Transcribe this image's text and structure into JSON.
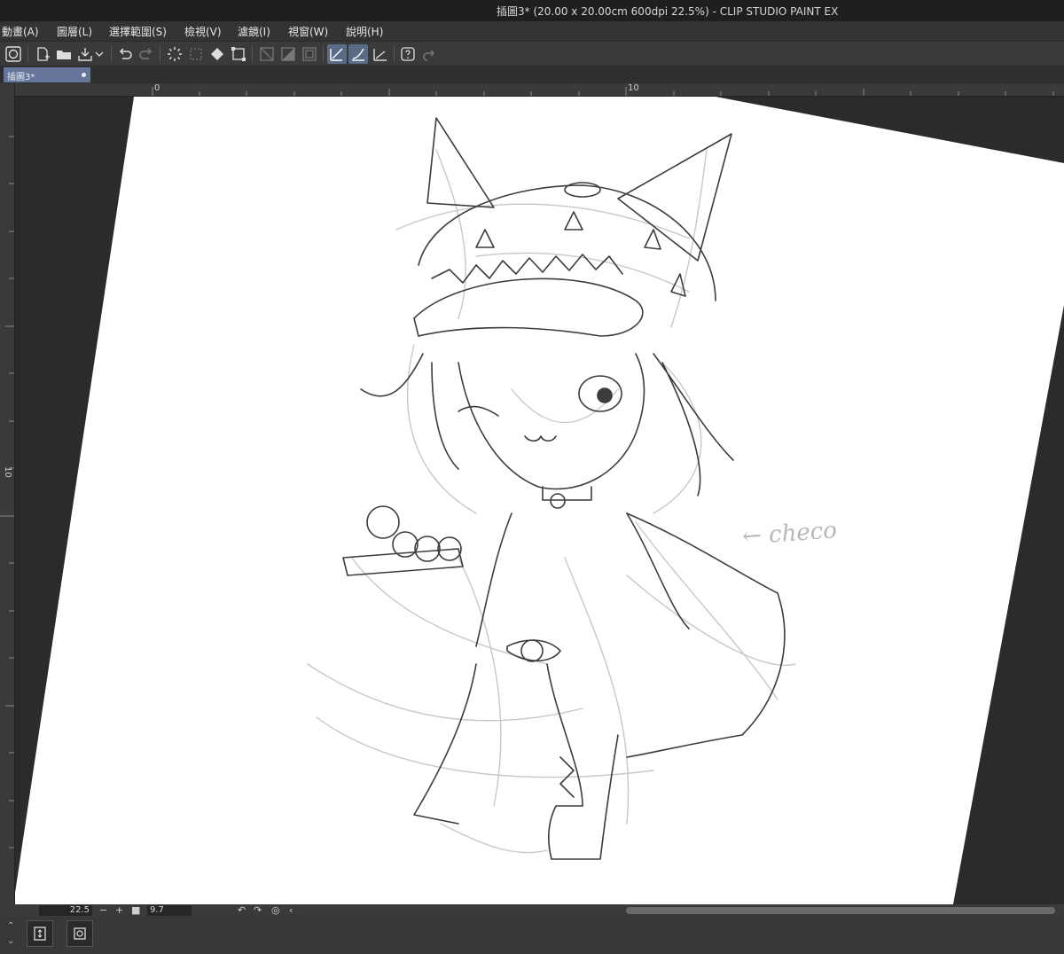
{
  "window": {
    "title": "插圖3* (20.00 x 20.00cm 600dpi 22.5%)  - CLIP STUDIO PAINT EX"
  },
  "menu": [
    "動畫(A)",
    "圖層(L)",
    "選擇範圍(S)",
    "檢視(V)",
    "濾鏡(I)",
    "視窗(W)",
    "說明(H)"
  ],
  "toolbar": {
    "icons": [
      "clip-studio-icon",
      "new-canvas-icon",
      "open-folder-icon",
      "export-icon",
      "dropdown-arrow-icon",
      "undo-icon",
      "redo-icon",
      "loading-spinner-icon",
      "deselect-icon",
      "fill-icon",
      "transform-icon",
      "clear-selection-icon",
      "invert-selection-icon",
      "show-selection-icon",
      "snap-ruler-icon",
      "snap-special-ruler-icon",
      "snap-grid-icon",
      "help-icon",
      "redo-alt-icon"
    ],
    "active": [
      "snap-ruler-icon",
      "snap-special-ruler-icon"
    ]
  },
  "tab": {
    "label": "插圖3*"
  },
  "ruler": {
    "h_labels": [
      "0",
      "10"
    ],
    "v_labels": [
      "10"
    ]
  },
  "canvas": {
    "annotation": "← checo"
  },
  "status": {
    "zoom": "22.5",
    "minus": "−",
    "plus": "+",
    "stop": "■",
    "angle": "9.7"
  },
  "colors": {
    "accent": "#65769a",
    "background": "#2b2b2b",
    "paper": "#ffffff"
  }
}
